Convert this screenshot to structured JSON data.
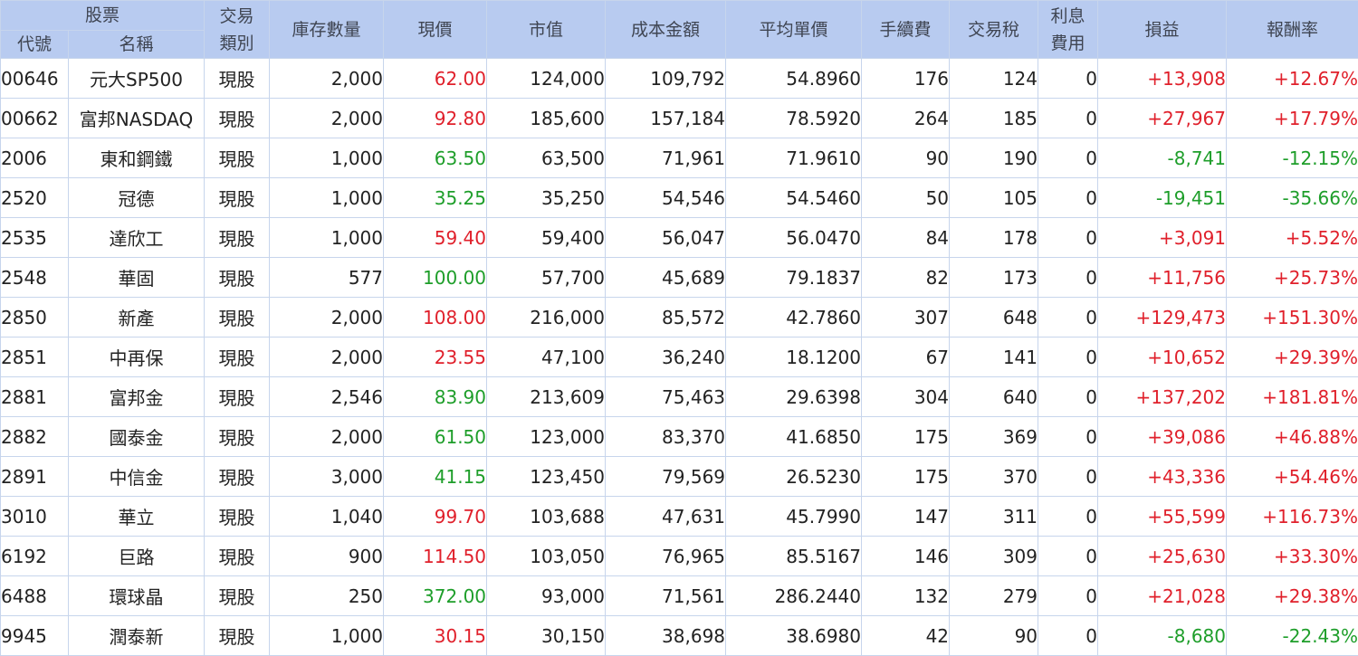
{
  "colors": {
    "header_bg": "#b8cbf0",
    "grid": "#c7d5ec",
    "up": "#e0202b",
    "down": "#1e9e2a"
  },
  "header": {
    "group_stock": "股票",
    "code": "代號",
    "name": "名稱",
    "type_line1": "交易",
    "type_line2": "類別",
    "qty": "庫存數量",
    "price": "現價",
    "market_value": "市值",
    "cost": "成本金額",
    "avg_price": "平均單價",
    "fee": "手續費",
    "tax": "交易稅",
    "interest_line1": "利息",
    "interest_line2": "費用",
    "pnl": "損益",
    "return": "報酬率"
  },
  "rows": [
    {
      "code": "00646",
      "name": "元大SP500",
      "type": "現股",
      "qty": "2,000",
      "price": "62.00",
      "price_dir": "up",
      "mv": "124,000",
      "cost": "109,792",
      "avg": "54.8960",
      "fee": "176",
      "tax": "124",
      "interest": "0",
      "pnl": "+13,908",
      "ret": "+12.67%",
      "pnl_dir": "up"
    },
    {
      "code": "00662",
      "name": "富邦NASDAQ",
      "type": "現股",
      "qty": "2,000",
      "price": "92.80",
      "price_dir": "up",
      "mv": "185,600",
      "cost": "157,184",
      "avg": "78.5920",
      "fee": "264",
      "tax": "185",
      "interest": "0",
      "pnl": "+27,967",
      "ret": "+17.79%",
      "pnl_dir": "up"
    },
    {
      "code": "2006",
      "name": "東和鋼鐵",
      "type": "現股",
      "qty": "1,000",
      "price": "63.50",
      "price_dir": "down",
      "mv": "63,500",
      "cost": "71,961",
      "avg": "71.9610",
      "fee": "90",
      "tax": "190",
      "interest": "0",
      "pnl": "-8,741",
      "ret": "-12.15%",
      "pnl_dir": "down"
    },
    {
      "code": "2520",
      "name": "冠德",
      "type": "現股",
      "qty": "1,000",
      "price": "35.25",
      "price_dir": "down",
      "mv": "35,250",
      "cost": "54,546",
      "avg": "54.5460",
      "fee": "50",
      "tax": "105",
      "interest": "0",
      "pnl": "-19,451",
      "ret": "-35.66%",
      "pnl_dir": "down"
    },
    {
      "code": "2535",
      "name": "達欣工",
      "type": "現股",
      "qty": "1,000",
      "price": "59.40",
      "price_dir": "up",
      "mv": "59,400",
      "cost": "56,047",
      "avg": "56.0470",
      "fee": "84",
      "tax": "178",
      "interest": "0",
      "pnl": "+3,091",
      "ret": "+5.52%",
      "pnl_dir": "up"
    },
    {
      "code": "2548",
      "name": "華固",
      "type": "現股",
      "qty": "577",
      "price": "100.00",
      "price_dir": "down",
      "mv": "57,700",
      "cost": "45,689",
      "avg": "79.1837",
      "fee": "82",
      "tax": "173",
      "interest": "0",
      "pnl": "+11,756",
      "ret": "+25.73%",
      "pnl_dir": "up"
    },
    {
      "code": "2850",
      "name": "新產",
      "type": "現股",
      "qty": "2,000",
      "price": "108.00",
      "price_dir": "up",
      "mv": "216,000",
      "cost": "85,572",
      "avg": "42.7860",
      "fee": "307",
      "tax": "648",
      "interest": "0",
      "pnl": "+129,473",
      "ret": "+151.30%",
      "pnl_dir": "up"
    },
    {
      "code": "2851",
      "name": "中再保",
      "type": "現股",
      "qty": "2,000",
      "price": "23.55",
      "price_dir": "up",
      "mv": "47,100",
      "cost": "36,240",
      "avg": "18.1200",
      "fee": "67",
      "tax": "141",
      "interest": "0",
      "pnl": "+10,652",
      "ret": "+29.39%",
      "pnl_dir": "up"
    },
    {
      "code": "2881",
      "name": "富邦金",
      "type": "現股",
      "qty": "2,546",
      "price": "83.90",
      "price_dir": "down",
      "mv": "213,609",
      "cost": "75,463",
      "avg": "29.6398",
      "fee": "304",
      "tax": "640",
      "interest": "0",
      "pnl": "+137,202",
      "ret": "+181.81%",
      "pnl_dir": "up"
    },
    {
      "code": "2882",
      "name": "國泰金",
      "type": "現股",
      "qty": "2,000",
      "price": "61.50",
      "price_dir": "down",
      "mv": "123,000",
      "cost": "83,370",
      "avg": "41.6850",
      "fee": "175",
      "tax": "369",
      "interest": "0",
      "pnl": "+39,086",
      "ret": "+46.88%",
      "pnl_dir": "up"
    },
    {
      "code": "2891",
      "name": "中信金",
      "type": "現股",
      "qty": "3,000",
      "price": "41.15",
      "price_dir": "down",
      "mv": "123,450",
      "cost": "79,569",
      "avg": "26.5230",
      "fee": "175",
      "tax": "370",
      "interest": "0",
      "pnl": "+43,336",
      "ret": "+54.46%",
      "pnl_dir": "up"
    },
    {
      "code": "3010",
      "name": "華立",
      "type": "現股",
      "qty": "1,040",
      "price": "99.70",
      "price_dir": "up",
      "mv": "103,688",
      "cost": "47,631",
      "avg": "45.7990",
      "fee": "147",
      "tax": "311",
      "interest": "0",
      "pnl": "+55,599",
      "ret": "+116.73%",
      "pnl_dir": "up"
    },
    {
      "code": "6192",
      "name": "巨路",
      "type": "現股",
      "qty": "900",
      "price": "114.50",
      "price_dir": "up",
      "mv": "103,050",
      "cost": "76,965",
      "avg": "85.5167",
      "fee": "146",
      "tax": "309",
      "interest": "0",
      "pnl": "+25,630",
      "ret": "+33.30%",
      "pnl_dir": "up"
    },
    {
      "code": "6488",
      "name": "環球晶",
      "type": "現股",
      "qty": "250",
      "price": "372.00",
      "price_dir": "down",
      "mv": "93,000",
      "cost": "71,561",
      "avg": "286.2440",
      "fee": "132",
      "tax": "279",
      "interest": "0",
      "pnl": "+21,028",
      "ret": "+29.38%",
      "pnl_dir": "up"
    },
    {
      "code": "9945",
      "name": "潤泰新",
      "type": "現股",
      "qty": "1,000",
      "price": "30.15",
      "price_dir": "up",
      "mv": "30,150",
      "cost": "38,698",
      "avg": "38.6980",
      "fee": "42",
      "tax": "90",
      "interest": "0",
      "pnl": "-8,680",
      "ret": "-22.43%",
      "pnl_dir": "down"
    }
  ]
}
